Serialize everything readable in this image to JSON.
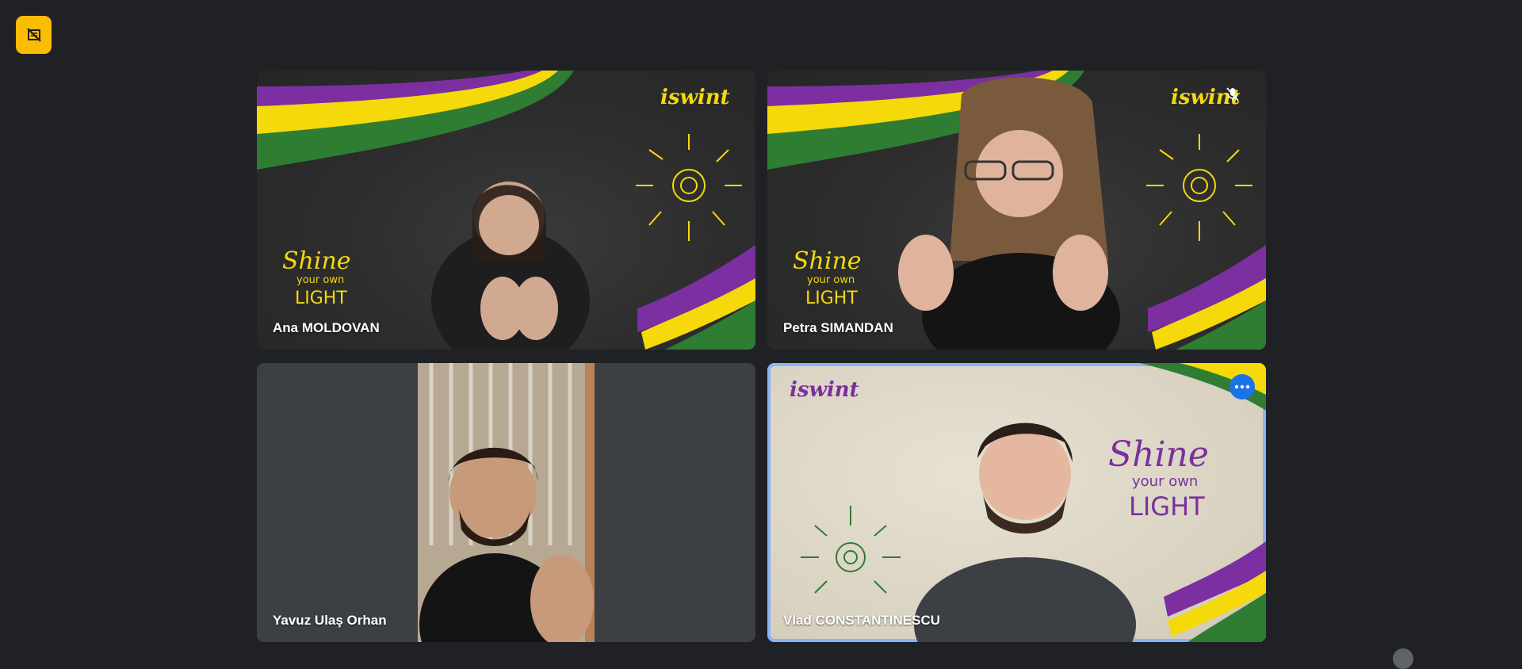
{
  "badge": {
    "icon": "hand-slash-icon",
    "color": "#fbbc04"
  },
  "participants": [
    {
      "name": "Ana MOLDOVAN",
      "background": "chalkboard"
    },
    {
      "name": "Petra SIMANDAN",
      "background": "chalkboard",
      "muted": true
    },
    {
      "name": "Yavuz Ulaş Orhan",
      "background": "plain"
    },
    {
      "name": "Vlad CONSTANTINESCU",
      "background": "paper",
      "active": true
    }
  ],
  "overlay": {
    "logo": "iswint",
    "slogan_l1": "Shine",
    "slogan_l2": "your own",
    "slogan_l3": "LIGHT"
  },
  "colors": {
    "purple": "#7b2fa0",
    "yellow": "#f5d90a",
    "green": "#2e7d32",
    "accent": "#8ab4f8",
    "menu": "#1a73e8"
  }
}
